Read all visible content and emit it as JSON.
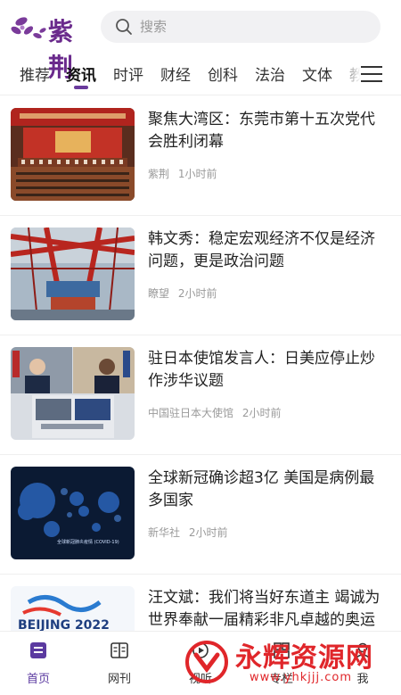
{
  "app": {
    "logo_text": "紫荆"
  },
  "search": {
    "placeholder": "搜索"
  },
  "tabs": [
    {
      "label": "推荐"
    },
    {
      "label": "资讯"
    },
    {
      "label": "时评"
    },
    {
      "label": "财经"
    },
    {
      "label": "创科"
    },
    {
      "label": "法治"
    },
    {
      "label": "文体"
    },
    {
      "label": "教"
    }
  ],
  "active_tab": "资讯",
  "news": [
    {
      "title": "聚焦大湾区：东莞市第十五次党代会胜利闭幕",
      "source": "紫荆",
      "time": "1小时前",
      "thumb": "conference-hall"
    },
    {
      "title": "韩文秀：稳定宏观经济不仅是经济问题，更是政治问题",
      "source": "瞭望",
      "time": "2小时前",
      "thumb": "port-cranes"
    },
    {
      "title": "驻日本使馆发言人：日美应停止炒作涉华议题",
      "source": "中国驻日本大使馆",
      "time": "2小时前",
      "thumb": "video-meeting"
    },
    {
      "title": "全球新冠确诊超3亿 美国是病例最多国家",
      "source": "新华社",
      "time": "2小时前",
      "thumb": "world-map",
      "thumb_caption": "全球新冠肺炎疫情 (COVID-19)"
    },
    {
      "title": "汪文斌：我们将当好东道主 竭诚为世界奉献一届精彩非凡卓越的奥运盛会",
      "source": "",
      "time": "",
      "thumb": "beijing-2022",
      "thumb_text": "BEIJING 2022"
    }
  ],
  "bottom_nav": [
    {
      "label": "首页",
      "icon": "home-icon"
    },
    {
      "label": "网刊",
      "icon": "magazine-icon"
    },
    {
      "label": "视听",
      "icon": "video-icon"
    },
    {
      "label": "专栏",
      "icon": "columns-icon"
    },
    {
      "label": "我",
      "icon": "user-icon"
    }
  ],
  "watermark": {
    "text": "永辉资源网",
    "url": "www.yhkjjj.com"
  },
  "colors": {
    "brand": "#6a2a8c",
    "accent": "#5b3aa0",
    "watermark": "#e0262a"
  }
}
